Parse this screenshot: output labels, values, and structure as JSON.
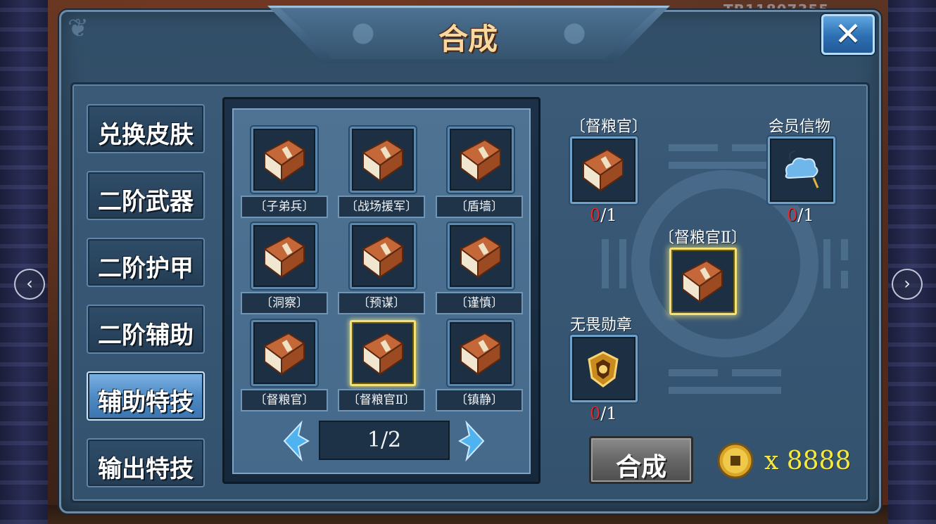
{
  "window": {
    "title": "合成",
    "close_glyph": "✕"
  },
  "background": {
    "code": "TB11807355"
  },
  "nav": {
    "prev_glyph": "‹",
    "next_glyph": "›"
  },
  "tabs": [
    {
      "label": "兑换皮肤",
      "active": false
    },
    {
      "label": "二阶武器",
      "active": false
    },
    {
      "label": "二阶护甲",
      "active": false
    },
    {
      "label": "二阶辅助",
      "active": false
    },
    {
      "label": "辅助特技",
      "active": true
    },
    {
      "label": "输出特技",
      "active": false
    }
  ],
  "grid": {
    "items": [
      {
        "label": "〔子弟兵〕",
        "icon": "skill-book-icon",
        "selected": false
      },
      {
        "label": "〔战场援军〕",
        "icon": "skill-book-icon",
        "selected": false
      },
      {
        "label": "〔盾墙〕",
        "icon": "skill-book-icon",
        "selected": false
      },
      {
        "label": "〔洞察〕",
        "icon": "skill-book-icon",
        "selected": false
      },
      {
        "label": "〔预谋〕",
        "icon": "skill-book-icon",
        "selected": false
      },
      {
        "label": "〔谨慎〕",
        "icon": "skill-book-icon",
        "selected": false
      },
      {
        "label": "〔督粮官〕",
        "icon": "skill-book-icon",
        "selected": false
      },
      {
        "label": "〔督粮官Ⅱ〕",
        "icon": "skill-book-icon",
        "selected": true
      },
      {
        "label": "〔镇静〕",
        "icon": "skill-book-icon",
        "selected": false
      }
    ],
    "pager": {
      "text": "1/2"
    }
  },
  "synthesis": {
    "materials": [
      {
        "name": "〔督粮官〕",
        "icon": "skill-book-icon",
        "have": "0",
        "need": "/1"
      },
      {
        "name": "会员信物",
        "icon": "cloud-token-icon",
        "have": "0",
        "need": "/1"
      },
      {
        "name": "无畏勋章",
        "icon": "shield-medal-icon",
        "have": "0",
        "need": "/1"
      }
    ],
    "result": {
      "name": "〔督粮官Ⅱ〕",
      "icon": "skill-book-icon"
    },
    "button_label": "合成",
    "currency": {
      "icon": "gold-coin-icon",
      "amount": "x 8888"
    }
  },
  "colors": {
    "panel": "#33526e",
    "selected_border": "#f3e27a",
    "shortage": "#e22a2a",
    "coin_text": "#f4ea3e"
  }
}
